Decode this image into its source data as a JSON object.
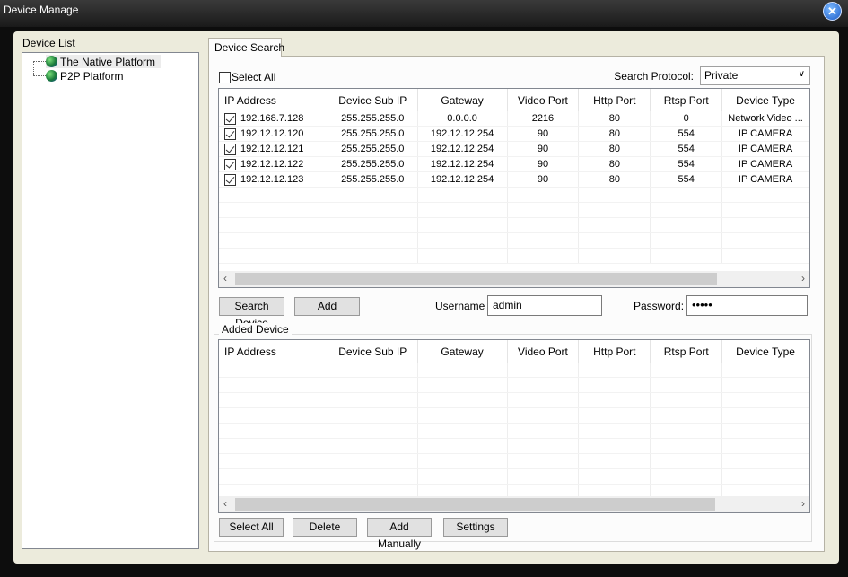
{
  "window": {
    "title": "Device Manage",
    "close_icon": "close-icon"
  },
  "device_list": {
    "label": "Device List",
    "items": [
      {
        "label": "The Native Platform",
        "icon": "globe-icon",
        "selected": true
      },
      {
        "label": "P2P Platform",
        "icon": "globe-icon"
      }
    ]
  },
  "tab": {
    "label": "Device Search"
  },
  "search": {
    "select_all_label": "Select All",
    "select_all_checked": false,
    "protocol_label": "Search Protocol:",
    "protocol_value": "Private",
    "columns": [
      "IP Address",
      "Device Sub IP",
      "Gateway",
      "Video Port",
      "Http Port",
      "Rtsp Port",
      "Device Type"
    ],
    "rows": [
      {
        "checked": true,
        "cells": [
          "192.168.7.128",
          "255.255.255.0",
          "0.0.0.0",
          "2216",
          "80",
          "0",
          "Network Video ..."
        ]
      },
      {
        "checked": true,
        "cells": [
          "192.12.12.120",
          "255.255.255.0",
          "192.12.12.254",
          "90",
          "80",
          "554",
          "IP CAMERA"
        ]
      },
      {
        "checked": true,
        "cells": [
          "192.12.12.121",
          "255.255.255.0",
          "192.12.12.254",
          "90",
          "80",
          "554",
          "IP CAMERA"
        ]
      },
      {
        "checked": true,
        "cells": [
          "192.12.12.122",
          "255.255.255.0",
          "192.12.12.254",
          "90",
          "80",
          "554",
          "IP CAMERA"
        ]
      },
      {
        "checked": true,
        "cells": [
          "192.12.12.123",
          "255.255.255.0",
          "192.12.12.254",
          "90",
          "80",
          "554",
          "IP CAMERA"
        ]
      }
    ]
  },
  "actions": {
    "search_device": "Search Device",
    "add": "Add",
    "username_label": "Username",
    "username_value": "admin",
    "password_label": "Password:",
    "password_value": "•••••"
  },
  "added": {
    "label": "Added Device",
    "columns": [
      "IP Address",
      "Device Sub IP",
      "Gateway",
      "Video Port",
      "Http Port",
      "Rtsp Port",
      "Device Type"
    ],
    "rows": []
  },
  "bottom_buttons": {
    "select_all": "Select All",
    "delete": "Delete",
    "add_manually": "Add Manually",
    "settings": "Settings"
  }
}
